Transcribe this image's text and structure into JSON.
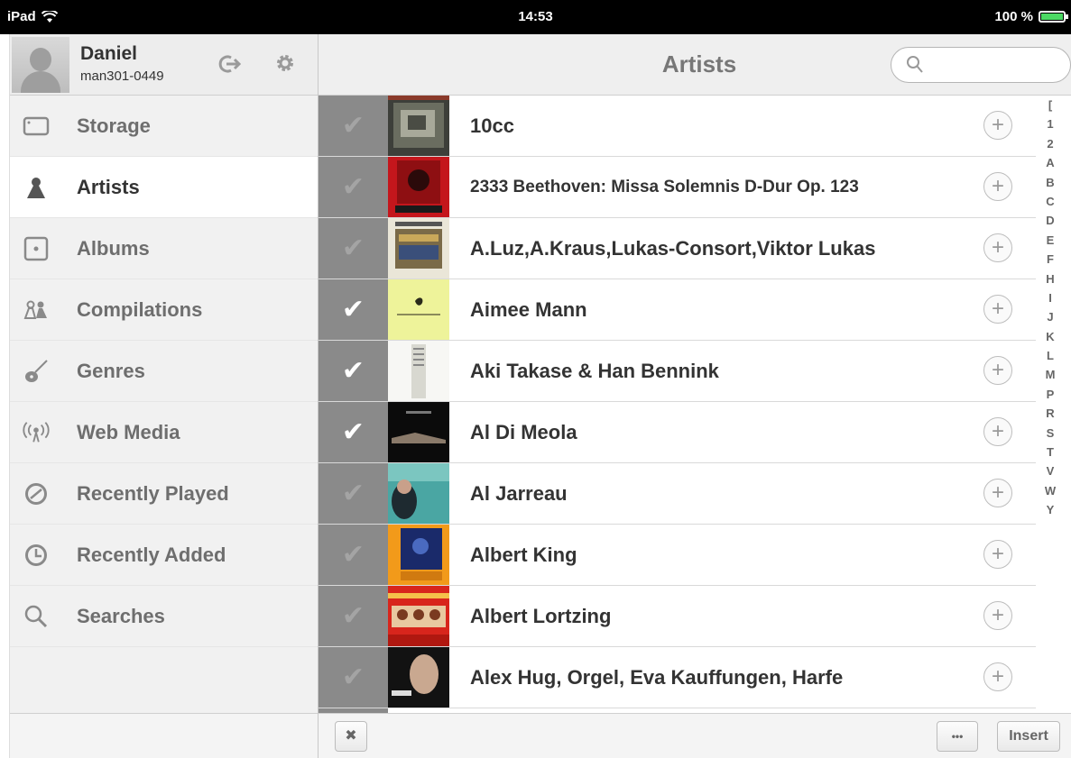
{
  "status_bar": {
    "device": "iPad",
    "time": "14:53",
    "battery": "100 %"
  },
  "sidebar": {
    "user": {
      "name": "Daniel",
      "id": "man301-0449"
    },
    "items": [
      {
        "label": "Storage",
        "icon": "storage-icon",
        "active": false
      },
      {
        "label": "Artists",
        "icon": "artist-icon",
        "active": true
      },
      {
        "label": "Albums",
        "icon": "album-icon",
        "active": false
      },
      {
        "label": "Compilations",
        "icon": "compilations-icon",
        "active": false
      },
      {
        "label": "Genres",
        "icon": "guitar-icon",
        "active": false
      },
      {
        "label": "Web Media",
        "icon": "broadcast-icon",
        "active": false
      },
      {
        "label": "Recently Played",
        "icon": "clock-played-icon",
        "active": false
      },
      {
        "label": "Recently Added",
        "icon": "clock-added-icon",
        "active": false
      },
      {
        "label": "Searches",
        "icon": "search-icon",
        "active": false
      }
    ]
  },
  "main": {
    "title": "Artists",
    "search": {
      "placeholder": ""
    },
    "artists": [
      {
        "name": "10cc",
        "checked": false
      },
      {
        "name": "2333 Beethoven: Missa Solemnis D-Dur Op. 123",
        "checked": false
      },
      {
        "name": "A.Luz,A.Kraus,Lukas-Consort,Viktor Lukas",
        "checked": false
      },
      {
        "name": "Aimee Mann",
        "checked": true
      },
      {
        "name": "Aki Takase & Han Bennink",
        "checked": true
      },
      {
        "name": "Al Di Meola",
        "checked": true
      },
      {
        "name": "Al Jarreau",
        "checked": false
      },
      {
        "name": "Albert King",
        "checked": false
      },
      {
        "name": "Albert Lortzing",
        "checked": false
      },
      {
        "name": "Alex Hug, Orgel, Eva Kauffungen, Harfe",
        "checked": false
      }
    ],
    "index": [
      "[",
      "1",
      "2",
      "A",
      "B",
      "C",
      "D",
      "E",
      "F",
      "H",
      "I",
      "J",
      "K",
      "L",
      "M",
      "P",
      "R",
      "S",
      "T",
      "V",
      "W",
      "Y"
    ],
    "footer": {
      "close_label": "✖",
      "more_label": "•••",
      "insert_label": "Insert"
    }
  }
}
